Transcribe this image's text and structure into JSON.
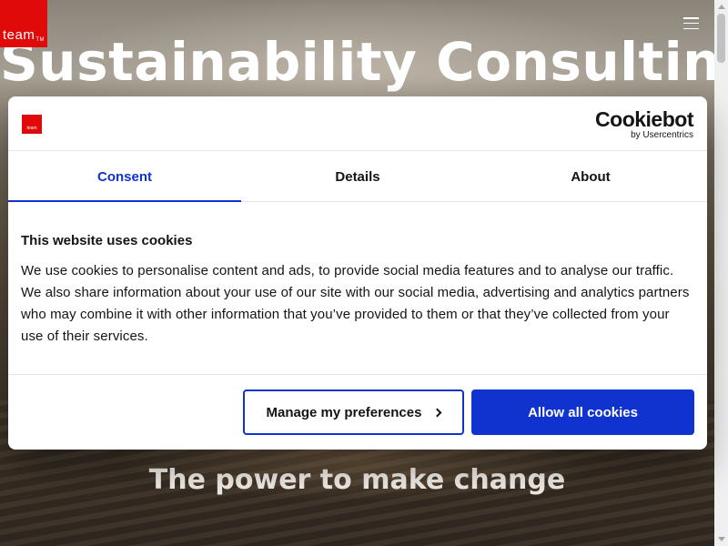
{
  "hero": {
    "title": "Sustainability Consulting",
    "subtitle": "The power to make change"
  },
  "logo": {
    "text": "team",
    "tm": "TM",
    "mini_text": "team"
  },
  "menu": {
    "icon": "hamburger-menu-icon"
  },
  "dialog": {
    "brand": {
      "name": "Cookiebot",
      "by": "by Usercentrics"
    },
    "tabs": [
      {
        "label": "Consent",
        "active": true
      },
      {
        "label": "Details",
        "active": false
      },
      {
        "label": "About",
        "active": false
      }
    ],
    "title": "This website uses cookies",
    "text": "We use cookies to personalise content and ads, to provide social media features and to analyse our traffic. We also share information about your use of our site with our social media, advertising and analytics partners who may combine it with other information that you’ve provided to them or that they’ve collected from your use of their services.",
    "manage_label": "Manage my preferences",
    "allow_label": "Allow all cookies"
  },
  "colors": {
    "accent": "#1032cf",
    "brand_red": "#e10a0a",
    "text": "#141414"
  }
}
